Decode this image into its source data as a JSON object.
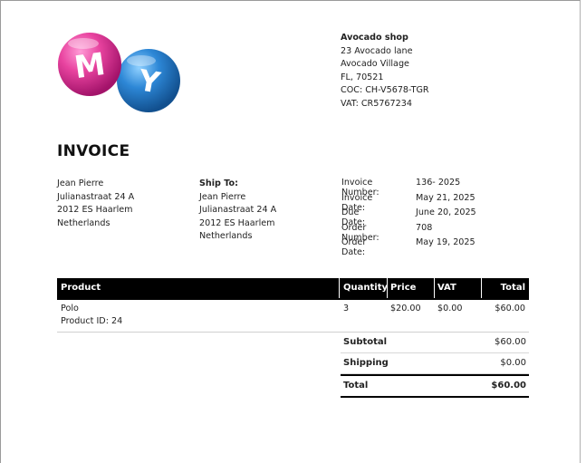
{
  "logo": {
    "letters": [
      "M",
      "Y"
    ],
    "colors": {
      "ball1": "#e0409a",
      "ball2": "#2a7fd0"
    }
  },
  "shop": {
    "name": "Avocado shop",
    "address": "23 Avocado lane",
    "village": "Avocado Village",
    "state_zip": "FL, 70521",
    "coc": "COC: CH-V5678-TGR",
    "vat": "VAT: CR5767234"
  },
  "title": "INVOICE",
  "bill_to": {
    "name": "Jean Pierre",
    "street": "Julianastraat 24 A",
    "city": "2012 ES Haarlem",
    "country": "Netherlands"
  },
  "ship_to": {
    "heading": "Ship To:",
    "name": "Jean Pierre",
    "street": "Julianastraat 24 A",
    "city": "2012 ES Haarlem",
    "country": "Netherlands"
  },
  "meta": [
    {
      "label": "Invoice Number:",
      "value": "136- 2025"
    },
    {
      "label": "Invoice Date:",
      "value": "May 21, 2025"
    },
    {
      "label": "Due Date:",
      "value": "June 20, 2025"
    },
    {
      "label": "Order Number:",
      "value": "708"
    },
    {
      "label": "Order Date:",
      "value": "May 19, 2025"
    }
  ],
  "table": {
    "headers": {
      "product": "Product",
      "quantity": "Quantity",
      "price": "Price",
      "vat": "VAT",
      "total": "Total"
    },
    "rows": [
      {
        "product": "Polo",
        "product_id": "Product ID: 24",
        "quantity": "3",
        "price": "$20.00",
        "vat": "$0.00",
        "total": "$60.00"
      }
    ]
  },
  "totals": [
    {
      "label": "Subtotal",
      "value": "$60.00"
    },
    {
      "label": "Shipping",
      "value": "$0.00"
    },
    {
      "label": "Total",
      "value": "$60.00"
    }
  ]
}
